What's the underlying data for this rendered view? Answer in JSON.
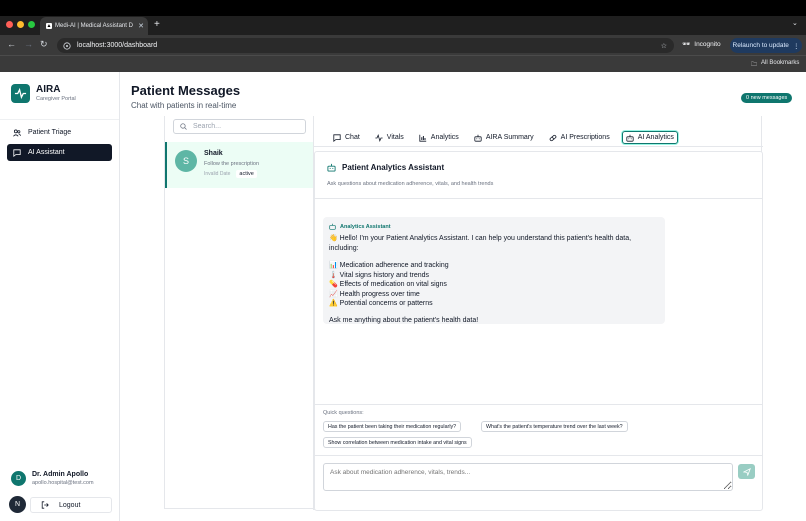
{
  "browser": {
    "tab_title": "Medi-AI | Medical Assistant D",
    "url": "localhost:3000/dashboard",
    "incognito_label": "Incognito",
    "relaunch_label": "Relaunch to update",
    "bookmarks_label": "All Bookmarks"
  },
  "brand": {
    "name": "AIRA",
    "subtitle": "Caregiver Portal"
  },
  "sidebar": {
    "items": [
      {
        "label": "Patient Triage",
        "icon": "users-icon",
        "active": false
      },
      {
        "label": "AI Assistant",
        "icon": "message-square-icon",
        "active": true
      }
    ],
    "user": {
      "initial": "D",
      "name": "Dr. Admin Apollo",
      "email": "apollo.hospital@test.com"
    },
    "logout_label": "Logout",
    "badge": "N"
  },
  "header": {
    "title": "Patient Messages",
    "subtitle": "Chat with patients in real-time",
    "new_messages": "0 new messages"
  },
  "search": {
    "placeholder": "Search..."
  },
  "conversation": {
    "initial": "S",
    "name": "Shaik",
    "last_message": "Follow the prescription",
    "date": "Invalid Date",
    "status": "active"
  },
  "tabs": [
    {
      "label": "Chat",
      "icon": "message-square-icon"
    },
    {
      "label": "Vitals",
      "icon": "activity-icon"
    },
    {
      "label": "Analytics",
      "icon": "bar-chart-icon"
    },
    {
      "label": "AIRA Summary",
      "icon": "bot-icon"
    },
    {
      "label": "AI Prescriptions",
      "icon": "pill-icon"
    },
    {
      "label": "AI Analytics",
      "icon": "bot-icon",
      "active": true
    }
  ],
  "assistant": {
    "title": "Patient Analytics Assistant",
    "subtitle": "Ask questions about medication adherence, vitals, and health trends",
    "message": {
      "sender": "Analytics Assistant",
      "intro": "👋 Hello! I'm your Patient Analytics Assistant. I can help you understand this patient's health data, including:",
      "items": [
        "📊 Medication adherence and tracking",
        "🌡️ Vital signs history and trends",
        "💊 Effects of medication on vital signs",
        "📈 Health progress over time",
        "⚠️ Potential concerns or patterns"
      ],
      "closing": "Ask me anything about the patient's health data!"
    },
    "quick_label": "Quick questions:",
    "quick_questions": [
      "Has the patient been taking their medication regularly?",
      "What's the patient's temperature trend over the last week?",
      "Show correlation between medication intake and vital signs"
    ],
    "input_placeholder": "Ask about medication adherence, vitals, trends..."
  },
  "colors": {
    "accent": "#0f766e",
    "dark": "#111827"
  }
}
